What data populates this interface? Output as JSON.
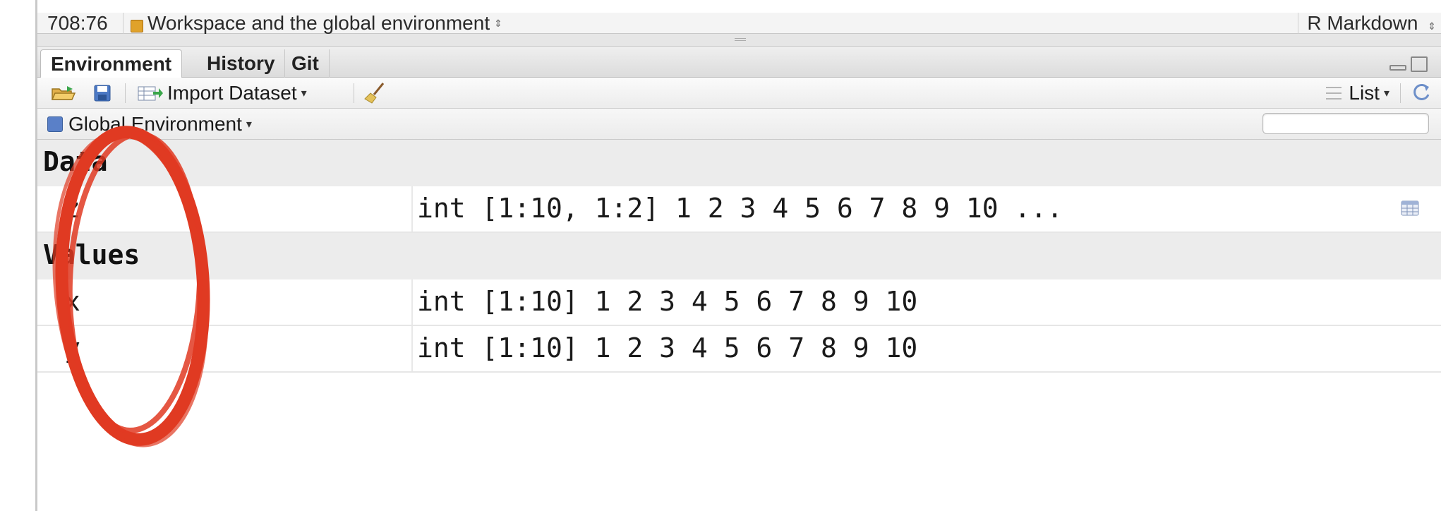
{
  "status_bar": {
    "cursor_position": "708:76",
    "scope": "Workspace and the global environment",
    "doc_type": "R Markdown"
  },
  "tabs": [
    {
      "label": "Environment",
      "active": true
    },
    {
      "label": "History",
      "active": false
    },
    {
      "label": "Git",
      "active": false
    }
  ],
  "toolbar": {
    "open_icon": "open-folder-icon",
    "save_icon": "save-icon",
    "import_label": "Import Dataset",
    "clear_icon": "broom-icon",
    "view_label": "List",
    "refresh_icon": "refresh-icon"
  },
  "env": {
    "selector_label": "Global Environment",
    "search_placeholder": ""
  },
  "sections": [
    {
      "title": "Data",
      "rows": [
        {
          "name": "z",
          "value": "int [1:10, 1:2] 1 2 3 4 5 6 7 8 9 10 ...",
          "has_viewer": true
        }
      ]
    },
    {
      "title": "Values",
      "rows": [
        {
          "name": "x",
          "value": "int [1:10] 1 2 3 4 5 6 7 8 9 10",
          "has_viewer": false
        },
        {
          "name": "y",
          "value": "int [1:10] 1 2 3 4 5 6 7 8 9 10",
          "has_viewer": false
        }
      ]
    }
  ],
  "colors": {
    "annotation_red": "#e03a22",
    "section_bg": "#ececec",
    "tab_bar": "#dcdcdc"
  }
}
